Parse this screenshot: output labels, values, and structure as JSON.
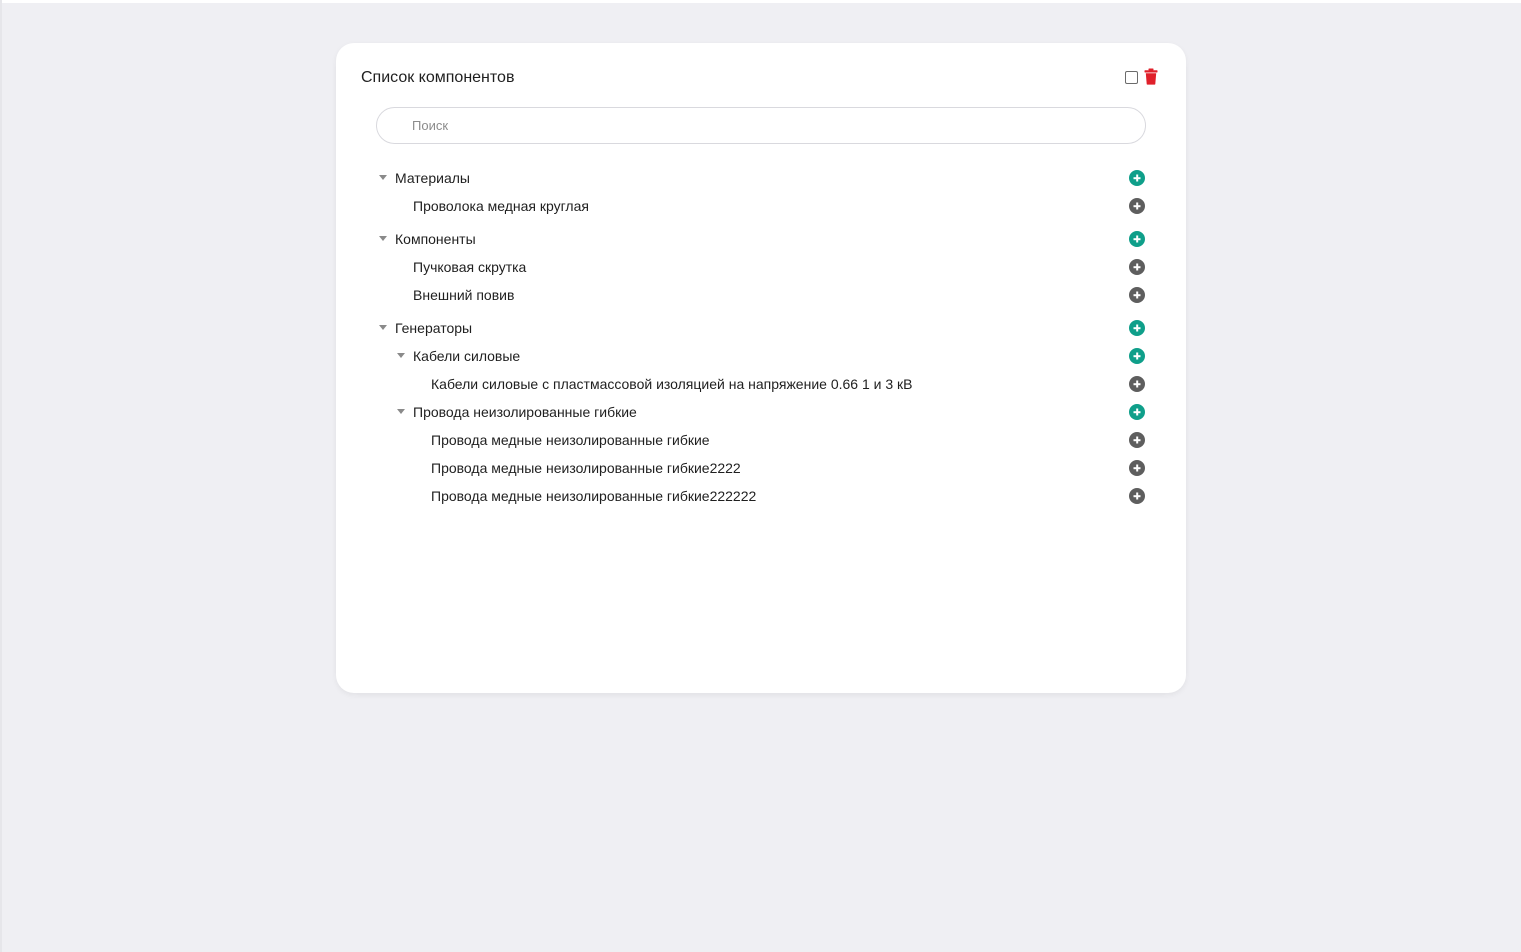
{
  "panel": {
    "title": "Список компонентов",
    "accent_color": "#0f9f8a",
    "danger_color": "#e0202a",
    "select_all": {
      "checked": false,
      "icon": "checkbox"
    },
    "delete": {
      "icon": "trash-icon"
    }
  },
  "search": {
    "placeholder": "Поиск",
    "value": ""
  },
  "tree": {
    "materials": {
      "label": "Материалы",
      "children": [
        "Проволока медная круглая"
      ]
    },
    "components": {
      "label": "Компоненты",
      "children": [
        "Пучковая скрутка",
        "Внешний повив"
      ]
    },
    "generators": {
      "label": "Генераторы",
      "power_cables": {
        "label": "Кабели силовые",
        "children": [
          "Кабели силовые с пластмассовой изоляцией на напряжение 0.66 1 и 3 кВ"
        ]
      },
      "bare_wires": {
        "label": "Провода неизолированные гибкие",
        "children": [
          "Провода медные неизолированные гибкие",
          "Провода медные неизолированные гибкие2222",
          "Провода медные неизолированные гибкие222222"
        ]
      }
    }
  }
}
